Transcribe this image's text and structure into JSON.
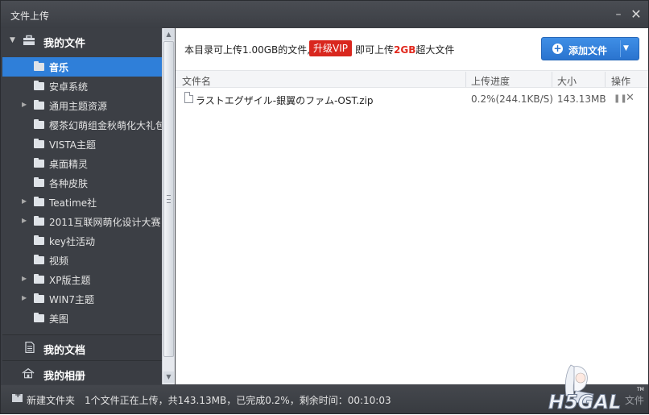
{
  "window": {
    "title": "文件上传"
  },
  "sidebar": {
    "my_files": "我的文件",
    "folders": [
      {
        "label": "音乐",
        "expandable": false,
        "selected": true
      },
      {
        "label": "安卓系统",
        "expandable": false
      },
      {
        "label": "通用主题资源",
        "expandable": true
      },
      {
        "label": "樱茶幻萌组金秋萌化大礼包",
        "expandable": false
      },
      {
        "label": "VISTA主题",
        "expandable": false
      },
      {
        "label": "桌面精灵",
        "expandable": false
      },
      {
        "label": "各种皮肤",
        "expandable": false
      },
      {
        "label": "Teatime社",
        "expandable": true
      },
      {
        "label": "2011互联网萌化设计大赛",
        "expandable": true
      },
      {
        "label": "key社活动",
        "expandable": false
      },
      {
        "label": "视频",
        "expandable": false
      },
      {
        "label": "XP版主题",
        "expandable": true
      },
      {
        "label": "WIN7主题",
        "expandable": true
      },
      {
        "label": "美图",
        "expandable": false
      }
    ],
    "my_docs": "我的文档",
    "my_photos": "我的相册"
  },
  "banner": {
    "text_before": "本目录可上传1.00GB的文件,",
    "vip_button": "升级VIP",
    "text_after_1": "即可上传",
    "text_highlight": "2GB",
    "text_after_2": "超大文件",
    "add_button": "添加文件"
  },
  "table": {
    "columns": {
      "name": "文件名",
      "progress": "上传进度",
      "size": "大小",
      "action": "操作"
    },
    "rows": [
      {
        "name": "ラストエグザイル-銀翼のファム-OST.zip",
        "progress": "0.2%(244.1KB/S)",
        "size": "143.13MB"
      }
    ]
  },
  "status": {
    "new_folder": "新建文件夹",
    "message": "1个文件正在上传，共143.13MB，已完成0.2%，剩余时间：00:10:03",
    "trailing": "文件"
  },
  "watermark": "H5GAL",
  "colors": {
    "accent": "#2f7fd9",
    "vip": "#d9271e",
    "chrome": "#3c3f45"
  }
}
